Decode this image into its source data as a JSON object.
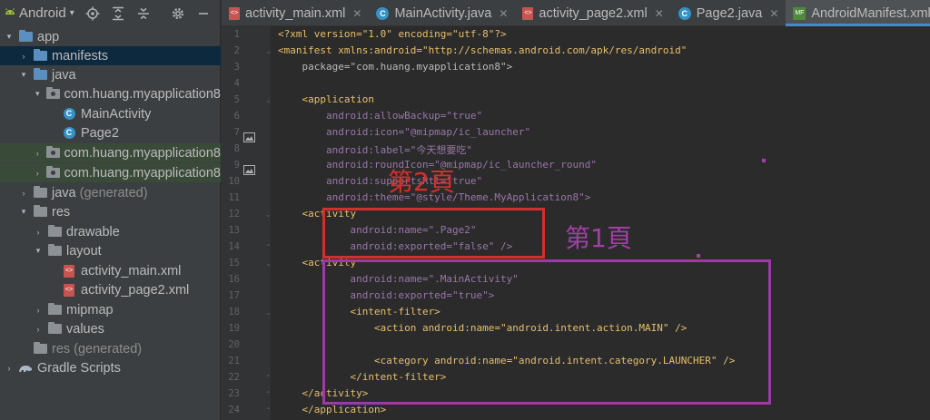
{
  "project_panel": {
    "title": "Android",
    "tree": [
      {
        "label": "app",
        "depth": 0,
        "expanded": true,
        "icon": "module-folder-icon"
      },
      {
        "label": "manifests",
        "depth": 1,
        "expanded": false,
        "icon": "folder-icon",
        "selected": true
      },
      {
        "label": "java",
        "depth": 1,
        "expanded": true,
        "icon": "folder-icon"
      },
      {
        "label": "com.huang.myapplication8",
        "depth": 2,
        "expanded": true,
        "icon": "package-icon"
      },
      {
        "label": "MainActivity",
        "depth": 3,
        "icon": "class-icon"
      },
      {
        "label": "Page2",
        "depth": 3,
        "icon": "class-icon"
      },
      {
        "label": "com.huang.myapplication8",
        "depth": 2,
        "expanded": false,
        "icon": "package-icon",
        "highlighted": true
      },
      {
        "label": "com.huang.myapplication8",
        "depth": 2,
        "expanded": false,
        "icon": "package-icon",
        "highlighted": true
      },
      {
        "label": "java",
        "suffix": "(generated)",
        "depth": 1,
        "expanded": false,
        "icon": "generated-folder-icon"
      },
      {
        "label": "res",
        "depth": 1,
        "expanded": true,
        "icon": "res-folder-icon"
      },
      {
        "label": "drawable",
        "depth": 2,
        "expanded": false,
        "icon": "folder-icon"
      },
      {
        "label": "layout",
        "depth": 2,
        "expanded": true,
        "icon": "folder-icon"
      },
      {
        "label": "activity_main.xml",
        "depth": 3,
        "icon": "xml-file-icon"
      },
      {
        "label": "activity_page2.xml",
        "depth": 3,
        "icon": "xml-file-icon"
      },
      {
        "label": "mipmap",
        "depth": 2,
        "expanded": false,
        "icon": "folder-icon"
      },
      {
        "label": "values",
        "depth": 2,
        "expanded": false,
        "icon": "folder-icon"
      },
      {
        "label": "res",
        "suffix": "(generated)",
        "depth": 1,
        "icon": "res-folder-icon"
      },
      {
        "label": "Gradle Scripts",
        "depth": 0,
        "expanded": false,
        "icon": "gradle-icon"
      }
    ]
  },
  "tabs": [
    {
      "label": "activity_main.xml",
      "icon": "xml-file-icon",
      "active": false
    },
    {
      "label": "MainActivity.java",
      "icon": "java-class-icon",
      "active": false
    },
    {
      "label": "activity_page2.xml",
      "icon": "xml-file-icon",
      "active": false
    },
    {
      "label": "Page2.java",
      "icon": "java-class-icon",
      "active": false
    },
    {
      "label": "AndroidManifest.xml",
      "icon": "manifest-file-icon",
      "active": true
    }
  ],
  "editor": {
    "lines": [
      "<?xml version=\"1.0\" encoding=\"utf-8\"?>",
      "<manifest xmlns:android=\"http://schemas.android.com/apk/res/android\"",
      "    package=\"com.huang.myapplication8\">",
      "",
      "    <application",
      "        android:allowBackup=\"true\"",
      "        android:icon=\"@mipmap/ic_launcher\"",
      "        android:label=\"今天想要吃\"",
      "        android:roundIcon=\"@mipmap/ic_launcher_round\"",
      "        android:supportsRtl=\"true\"",
      "        android:theme=\"@style/Theme.MyApplication8\">",
      "    <activity",
      "            android:name=\".Page2\"",
      "            android:exported=\"false\" />",
      "    <activity",
      "            android:name=\".MainActivity\"",
      "            android:exported=\"true\">",
      "            <intent-filter>",
      "                <action android:name=\"android.intent.action.MAIN\" />",
      "",
      "                <category android:name=\"android.intent.category.LAUNCHER\" />",
      "            </intent-filter>",
      "    </activity>",
      "    </application>"
    ]
  },
  "annotations": {
    "page2_label": "第2頁",
    "page1_label": "第1頁"
  },
  "colors": {
    "red_box": "#d32f2f",
    "purple_box": "#9c3aa8",
    "active_tab_underline": "#4a88c7"
  }
}
